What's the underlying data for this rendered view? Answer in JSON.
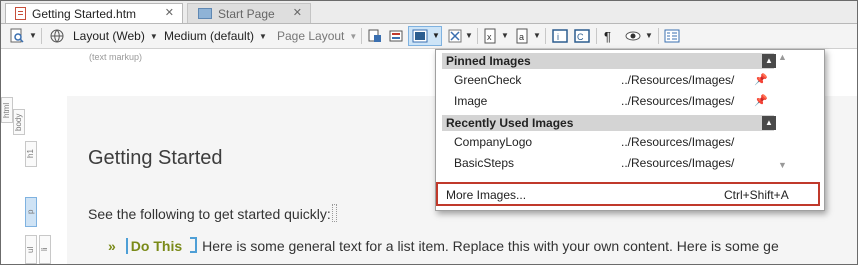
{
  "tabs": [
    {
      "label": "Getting Started.htm",
      "active": true
    },
    {
      "label": "Start Page",
      "active": false
    }
  ],
  "toolbar": {
    "layout": "Layout (Web)",
    "medium": "Medium (default)",
    "page_layout": "Page Layout",
    "pilcrow": "¶"
  },
  "editor": {
    "markup_hint": "(text markup)",
    "tags": [
      "html",
      "body",
      "h1",
      "p",
      "ul",
      "li"
    ],
    "heading": "Getting Started",
    "paragraph": "See the following to get started quickly:",
    "bullet_marker": "»",
    "bullet_term": "Do This",
    "bullet_text": "Here is some general text for a list item. Replace this with your own content. Here is some ge"
  },
  "dropdown": {
    "pinned_header": "Pinned Images",
    "pinned": [
      {
        "name": "GreenCheck",
        "path": "../Resources/Images/"
      },
      {
        "name": "Image",
        "path": "../Resources/Images/"
      }
    ],
    "recent_header": "Recently Used Images",
    "recent": [
      {
        "name": "CompanyLogo",
        "path": "../Resources/Images/"
      },
      {
        "name": "BasicSteps",
        "path": "../Resources/Images/"
      }
    ],
    "more_label": "More Images...",
    "more_shortcut": "Ctrl+Shift+A"
  },
  "colors": {
    "highlight_border": "#c0392b",
    "term_color": "#7a8a18",
    "tag_blue": "#4e9fd6"
  }
}
